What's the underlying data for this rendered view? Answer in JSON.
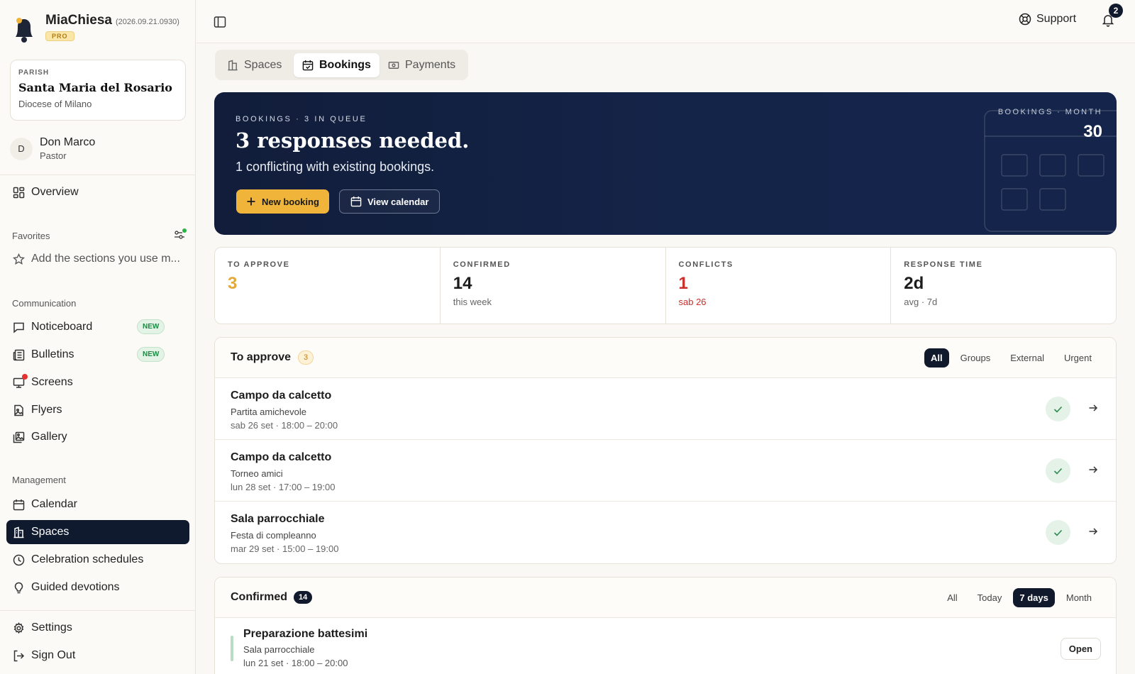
{
  "app": {
    "name": "MiaChiesa",
    "version": "(2026.09.21.0930)",
    "tier": "PRO"
  },
  "parish": {
    "label": "PARISH",
    "name": "Santa Maria del Rosario",
    "diocese": "Diocese of Milano"
  },
  "user": {
    "initial": "D",
    "name": "Don Marco",
    "role": "Pastor"
  },
  "sidebar": {
    "overview": "Overview",
    "favorites_title": "Favorites",
    "favorites_hint": "Add the sections you use m...",
    "communication_title": "Communication",
    "communication": [
      {
        "label": "Noticeboard",
        "badge": "NEW"
      },
      {
        "label": "Bulletins",
        "badge": "NEW"
      },
      {
        "label": "Screens"
      },
      {
        "label": "Flyers"
      },
      {
        "label": "Gallery"
      }
    ],
    "management_title": "Management",
    "management": [
      {
        "label": "Calendar"
      },
      {
        "label": "Spaces",
        "active": true
      },
      {
        "label": "Celebration schedules"
      },
      {
        "label": "Guided devotions"
      }
    ],
    "settings": "Settings",
    "signout": "Sign Out"
  },
  "topbar": {
    "support": "Support",
    "notifications": "2"
  },
  "tabs": [
    "Spaces",
    "Bookings",
    "Payments"
  ],
  "active_tab": "Bookings",
  "hero": {
    "kicker": "BOOKINGS · 3 IN QUEUE",
    "title": "3 responses needed.",
    "subtitle": "1 conflicting with existing bookings.",
    "primary": "New booking",
    "secondary": "View calendar",
    "month_label": "BOOKINGS · MONTH",
    "month_value": "30"
  },
  "stats": [
    {
      "label": "TO APPROVE",
      "value": "3",
      "sub": "",
      "color": "#e2a93b"
    },
    {
      "label": "CONFIRMED",
      "value": "14",
      "sub": "this week",
      "color": "#1c1c1c"
    },
    {
      "label": "CONFLICTS",
      "value": "1",
      "sub": "sab 26",
      "color": "#c9302c"
    },
    {
      "label": "RESPONSE TIME",
      "value": "2d",
      "sub": "avg · 7d",
      "color": "#1c1c1c"
    }
  ],
  "to_approve": {
    "title": "To approve",
    "count": "3",
    "filters": [
      "All",
      "Groups",
      "External",
      "Urgent"
    ],
    "active_filter": "All",
    "rows": [
      {
        "title": "Campo da calcetto",
        "sub": "Partita amichevole",
        "date": "sab 26 set · 18:00 – 20:00"
      },
      {
        "title": "Campo da calcetto",
        "sub": "Torneo amici",
        "date": "lun 28 set · 17:00 – 19:00"
      },
      {
        "title": "Sala parrocchiale",
        "sub": "Festa di compleanno",
        "date": "mar 29 set · 15:00 – 19:00"
      }
    ]
  },
  "confirmed": {
    "title": "Confirmed",
    "count": "14",
    "filters": [
      "All",
      "Today",
      "7 days",
      "Month"
    ],
    "active_filter": "7 days",
    "rows": [
      {
        "title": "Preparazione battesimi",
        "sub": "Sala parrocchiale",
        "date": "lun 21 set · 18:00 – 20:00",
        "action": "Open"
      }
    ]
  }
}
